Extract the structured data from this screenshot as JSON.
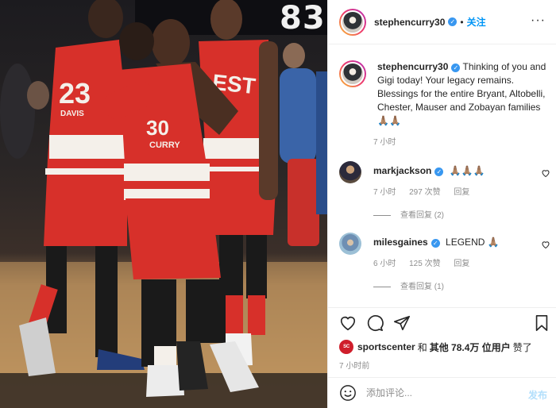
{
  "photo": {
    "scoreboard_number": "83",
    "jersey_numbers": [
      "23",
      "30"
    ],
    "jersey_names": [
      "DAVIS",
      "CURRY"
    ],
    "jersey_wordmark": "WEST"
  },
  "header": {
    "username": "stephencurry30",
    "separator": "•",
    "follow_label": "关注",
    "more_label": "···",
    "verified_icon": "verified-badge-icon"
  },
  "caption": {
    "username": "stephencurry30",
    "text": "Thinking of you and Gigi today! Your legacy remains. Blessings for the entire Bryant, Altobelli, Chester, Mauser and Zobayan families 🙏🏽🙏🏽",
    "time": "7 小时"
  },
  "comments": [
    {
      "username": "markjackson",
      "text": "🙏🏽🙏🏽🙏🏽",
      "time": "7 小时",
      "likes": "297 次赞",
      "reply_label": "回复",
      "view_replies": "查看回复 (2)"
    },
    {
      "username": "milesgaines",
      "text": "LEGEND 🙏🏽",
      "time": "6 小时",
      "likes": "125 次赞",
      "reply_label": "回复",
      "view_replies": "查看回复 (1)"
    }
  ],
  "actions": {
    "liked_by_logo": "SC",
    "liked_by_user": "sportscenter",
    "liked_by_and": "和",
    "liked_by_others": "其他 78.4万 位用户",
    "liked_by_suffix": "赞了",
    "post_time": "7 小时前"
  },
  "add_comment": {
    "placeholder": "添加评论...",
    "post_label": "发布"
  },
  "colors": {
    "accent_blue": "#0095f6",
    "post_button_disabled": "#b2dffc",
    "muted_text": "#8e8e8e",
    "jersey_red": "#d7302a"
  }
}
